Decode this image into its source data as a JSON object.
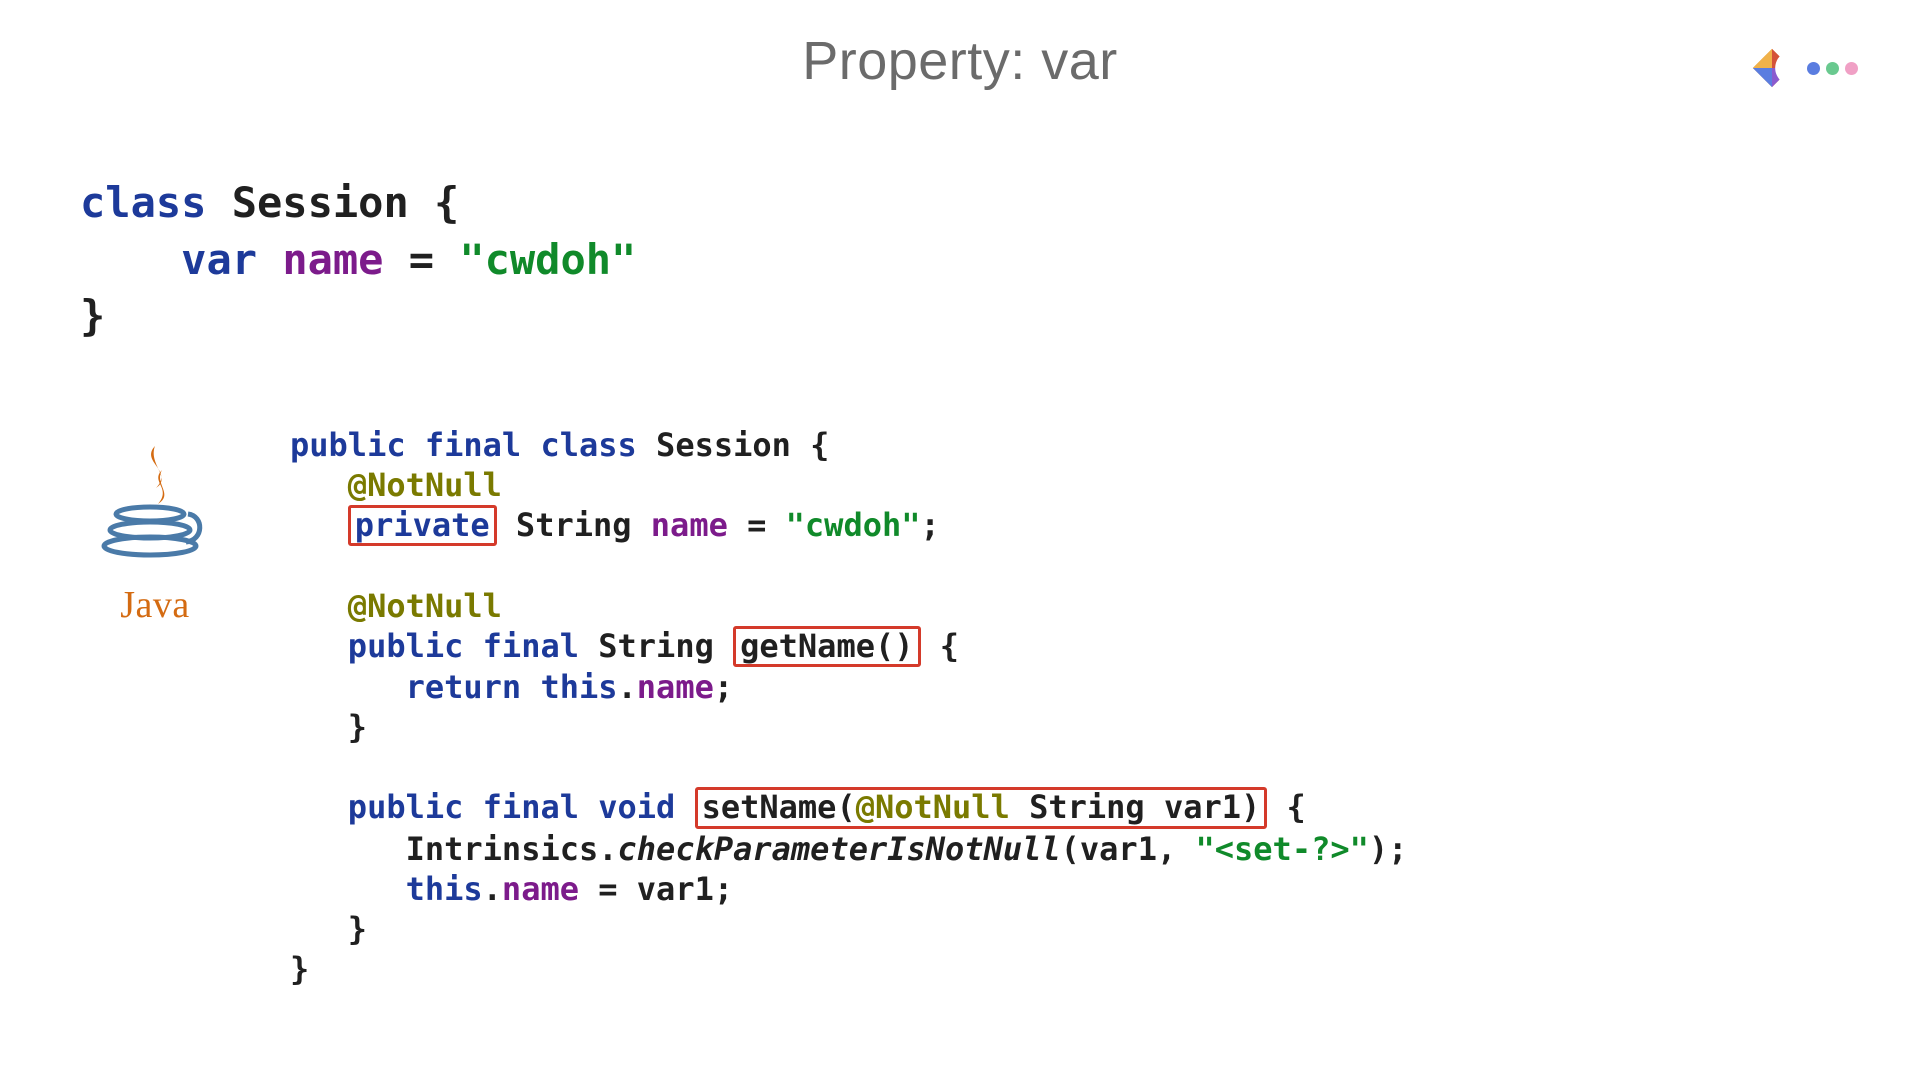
{
  "slide": {
    "title": "Property: var"
  },
  "kotlin": {
    "kw_class": "class",
    "class_name": "Session",
    "open_brace": " {",
    "indent1": "    ",
    "kw_var": "var",
    "prop_name": "name",
    "eq": " = ",
    "prop_val": "\"cwdoh\"",
    "close_brace": "}"
  },
  "java": {
    "l1_kw": "public final class",
    "l1_name": " Session {",
    "l2_ann": "@NotNull",
    "l3_kw_private": "private",
    "l3_type": " String ",
    "l3_name": "name",
    "l3_eq": " = ",
    "l3_val": "\"cwdoh\"",
    "l3_semi": ";",
    "l5_ann": "@NotNull",
    "l6_kw": "public final",
    "l6_type": " String ",
    "l6_get": "getName()",
    "l6_brace": " {",
    "l7_kw": "return this",
    "l7_dot": ".",
    "l7_name": "name",
    "l7_semi": ";",
    "l8_close": "}",
    "l10_kw": "public final void",
    "l10_set": "setName(",
    "l10_ann": "@NotNull",
    "l10_rest": " String var1)",
    "l10_brace": " {",
    "l11_pre": "Intrinsics.",
    "l11_call": "checkParameterIsNotNull",
    "l11_args_a": "(var1, ",
    "l11_str": "\"<set-?>\"",
    "l11_args_b": ");",
    "l12_kw": "this",
    "l12_dot": ".",
    "l12_name": "name",
    "l12_rest": " = var1;",
    "l13_close": "}",
    "l14_close": "}"
  },
  "logos": {
    "java_text": "Java"
  }
}
